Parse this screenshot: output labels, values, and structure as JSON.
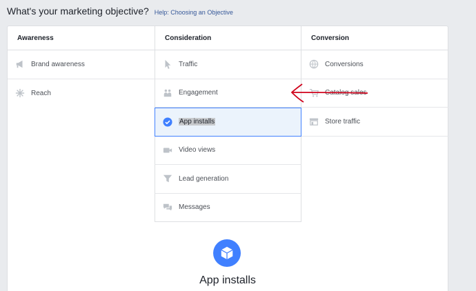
{
  "header": {
    "question": "What's your marketing objective?",
    "help_link": "Help: Choosing an Objective"
  },
  "columns": {
    "awareness": {
      "title": "Awareness",
      "items": [
        {
          "label": "Brand awareness",
          "icon": "megaphone-icon"
        },
        {
          "label": "Reach",
          "icon": "reach-icon"
        }
      ]
    },
    "consideration": {
      "title": "Consideration",
      "items": [
        {
          "label": "Traffic",
          "icon": "cursor-icon"
        },
        {
          "label": "Engagement",
          "icon": "people-icon"
        },
        {
          "label": "App installs",
          "icon": "check-circle-icon",
          "selected": true
        },
        {
          "label": "Video views",
          "icon": "video-camera-icon"
        },
        {
          "label": "Lead generation",
          "icon": "funnel-icon"
        },
        {
          "label": "Messages",
          "icon": "chat-bubbles-icon"
        }
      ]
    },
    "conversion": {
      "title": "Conversion",
      "items": [
        {
          "label": "Conversions",
          "icon": "globe-icon"
        },
        {
          "label": "Catalog sales",
          "icon": "cart-icon"
        },
        {
          "label": "Store traffic",
          "icon": "store-icon"
        }
      ]
    }
  },
  "selected_detail": {
    "title": "App installs",
    "icon": "cube-icon"
  },
  "colors": {
    "accent": "#4080ff",
    "selected_bg": "#ebf3fc",
    "annotation": "#d0021b",
    "icon_gray": "#bec3c9"
  }
}
